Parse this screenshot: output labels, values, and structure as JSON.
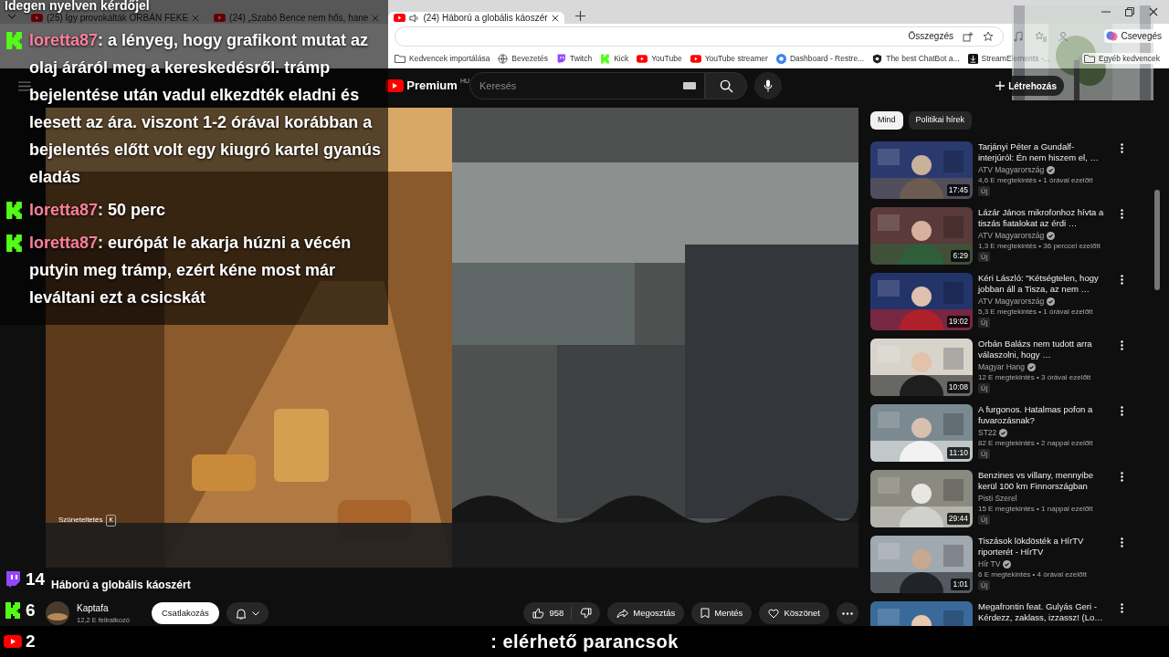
{
  "browser": {
    "tabs": [
      {
        "title": "(25) Így provokálták ORBÁN FEKE",
        "selected": false,
        "audio": false
      },
      {
        "title": "(24) „Szabó Bence nem hős, hane",
        "selected": false,
        "audio": false
      },
      {
        "title": "(24) Háború a globális káoszér",
        "selected": true,
        "audio": true
      }
    ],
    "summary_button": "Összegzés",
    "chat_button": "Csevegés",
    "bookmarks": [
      "Kedvencek importálása",
      "Bevezetés",
      "Twitch",
      "Kick",
      "YouTube",
      "YouTube streamer",
      "Dashboard - Restre...",
      "The best ChatBot a...",
      "StreamElements -..."
    ],
    "other_bookmarks": "Egyéb kedvencek"
  },
  "youtube": {
    "logo": "Premium",
    "region": "HU",
    "search": {
      "placeholder": "Keresés"
    },
    "create_button": "Létrehozás",
    "player": {
      "tooltip": {
        "label": "Szüneteltetés",
        "key": "K"
      }
    },
    "video": {
      "title": "Háború a globális káoszért",
      "channel": "Kaptafa",
      "subscribers": "12,2 E feliratkozó",
      "join_button": "Csatlakozás",
      "likes": "958",
      "share": "Megosztás",
      "save": "Mentés",
      "thanks": "Köszönet"
    },
    "chips": [
      {
        "label": "Mind",
        "selected": true
      },
      {
        "label": "Politikai hírek",
        "selected": false
      }
    ],
    "recommendations": [
      {
        "title": "Tarjányi Péter a Gundalf-interjúról: Én nem hiszem el, …",
        "channel": "ATV Magyarország",
        "verified": true,
        "meta": "4,6 E megtekintés • 1 órával ezelőtt",
        "badge": "Új",
        "duration": "17:45"
      },
      {
        "title": "Lázár János mikrofonhoz hívta a tiszás fiatalokat az érdi …",
        "channel": "ATV Magyarország",
        "verified": true,
        "meta": "1,3 E megtekintés • 36 perccel ezelőtt",
        "badge": "Új",
        "duration": "6:29"
      },
      {
        "title": "Kéri László: \"Kétségtelen, hogy jobban áll a Tisza, az nem …",
        "channel": "ATV Magyarország",
        "verified": true,
        "meta": "5,3 E megtekintés • 1 órával ezelőtt",
        "badge": "Új",
        "duration": "19:02"
      },
      {
        "title": "Orbán Balázs nem tudott arra válaszolni, hogy …",
        "channel": "Magyar Hang",
        "verified": true,
        "meta": "12 E megtekintés • 3 órával ezelőtt",
        "badge": "Új",
        "duration": "10:08"
      },
      {
        "title": "A furgonos. Hatalmas pofon a fuvarozásnak?",
        "channel": "ST22",
        "verified": true,
        "meta": "82 E megtekintés • 2 nappal ezelőtt",
        "badge": "Új",
        "duration": "11:10"
      },
      {
        "title": "Benzines vs villany, mennyibe kerül 100 km Finnországban",
        "channel": "Pisti Szerel",
        "verified": false,
        "meta": "15 E megtekintés • 1 nappal ezelőtt",
        "badge": "Új",
        "duration": "29:44"
      },
      {
        "title": "Tiszások lökdösték a HírTV riporterét - HírTV",
        "channel": "Hír TV",
        "verified": true,
        "meta": "6 E megtekintés • 4 órával ezelőtt",
        "badge": "Új",
        "duration": "1:01"
      },
      {
        "title": "Megafrontin feat. Gulyás Geri - Kérdezz, zaklass, izzassz! (Lo…"
      }
    ]
  },
  "overlay_chat": {
    "header": "Idegen nyelven kérdőjel",
    "messages": [
      {
        "kind": "kick",
        "username": "loretta87",
        "text": ": a lényeg, hogy grafikont mutat az olaj áráról meg a kereskedésről. trámp bejelentése után vadul elkezdték eladni és leesett az ára. viszont 1-2 órával korábban a bejelentés előtt volt egy kiugró kartel gyanús eladás"
      },
      {
        "kind": "kick",
        "username": "loretta87",
        "text": ": 50 perc"
      },
      {
        "kind": "kick",
        "username": "loretta87",
        "text": ": európát le akarja húzni a vécén putyin meg trámp, ezért kéne most már leváltani ezt a csicskát"
      }
    ]
  },
  "stream_counters": [
    {
      "kind": "twitch",
      "count": "14"
    },
    {
      "kind": "kick",
      "count": "6"
    },
    {
      "kind": "youtube",
      "count": "2"
    }
  ],
  "bottom_bar": ": elérhető parancsok"
}
